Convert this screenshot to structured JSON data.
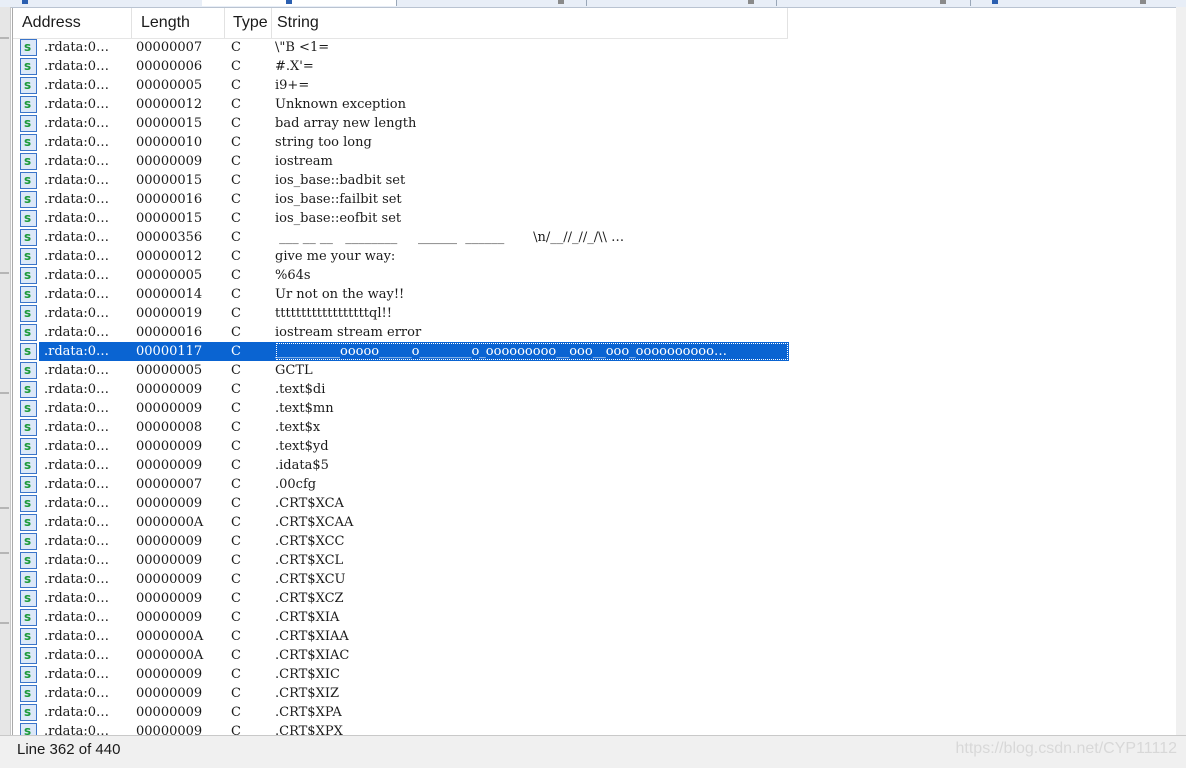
{
  "columns": {
    "address": "Address",
    "length": "Length",
    "type": "Type",
    "string": "String"
  },
  "rows": [
    {
      "address": ".rdata:0…",
      "length": "00000007",
      "type": "C",
      "string": "\\\"B <1="
    },
    {
      "address": ".rdata:0…",
      "length": "00000006",
      "type": "C",
      "string": "#.X'="
    },
    {
      "address": ".rdata:0…",
      "length": "00000005",
      "type": "C",
      "string": "i9+="
    },
    {
      "address": ".rdata:0…",
      "length": "00000012",
      "type": "C",
      "string": "Unknown exception"
    },
    {
      "address": ".rdata:0…",
      "length": "00000015",
      "type": "C",
      "string": "bad array new length"
    },
    {
      "address": ".rdata:0…",
      "length": "00000010",
      "type": "C",
      "string": "string too long"
    },
    {
      "address": ".rdata:0…",
      "length": "00000009",
      "type": "C",
      "string": "iostream"
    },
    {
      "address": ".rdata:0…",
      "length": "00000015",
      "type": "C",
      "string": "ios_base::badbit set"
    },
    {
      "address": ".rdata:0…",
      "length": "00000016",
      "type": "C",
      "string": "ios_base::failbit set"
    },
    {
      "address": ".rdata:0…",
      "length": "00000015",
      "type": "C",
      "string": "ios_base::eofbit set"
    },
    {
      "address": ".rdata:0…",
      "length": "00000356",
      "type": "C",
      "string": " ___ __ __   ________     ______  ______       \\n/__//_//_/\\\\ …"
    },
    {
      "address": ".rdata:0…",
      "length": "00000012",
      "type": "C",
      "string": "give me your way:"
    },
    {
      "address": ".rdata:0…",
      "length": "00000005",
      "type": "C",
      "string": "%64s"
    },
    {
      "address": ".rdata:0…",
      "length": "00000014",
      "type": "C",
      "string": "Ur not on the way!!"
    },
    {
      "address": ".rdata:0…",
      "length": "00000019",
      "type": "C",
      "string": "ttttttttttttttttttql!!"
    },
    {
      "address": ".rdata:0…",
      "length": "00000016",
      "type": "C",
      "string": "iostream stream error"
    },
    {
      "address": ".rdata:0…",
      "length": "00000117",
      "type": "C",
      "string": "__________ooooo_____o________o_ooooooooo__ooo__ooo_oooooooooo…",
      "selected": true
    },
    {
      "address": ".rdata:0…",
      "length": "00000005",
      "type": "C",
      "string": "GCTL"
    },
    {
      "address": ".rdata:0…",
      "length": "00000009",
      "type": "C",
      "string": ".text$di"
    },
    {
      "address": ".rdata:0…",
      "length": "00000009",
      "type": "C",
      "string": ".text$mn"
    },
    {
      "address": ".rdata:0…",
      "length": "00000008",
      "type": "C",
      "string": ".text$x"
    },
    {
      "address": ".rdata:0…",
      "length": "00000009",
      "type": "C",
      "string": ".text$yd"
    },
    {
      "address": ".rdata:0…",
      "length": "00000009",
      "type": "C",
      "string": ".idata$5"
    },
    {
      "address": ".rdata:0…",
      "length": "00000007",
      "type": "C",
      "string": ".00cfg"
    },
    {
      "address": ".rdata:0…",
      "length": "00000009",
      "type": "C",
      "string": ".CRT$XCA"
    },
    {
      "address": ".rdata:0…",
      "length": "0000000A",
      "type": "C",
      "string": ".CRT$XCAA"
    },
    {
      "address": ".rdata:0…",
      "length": "00000009",
      "type": "C",
      "string": ".CRT$XCC"
    },
    {
      "address": ".rdata:0…",
      "length": "00000009",
      "type": "C",
      "string": ".CRT$XCL"
    },
    {
      "address": ".rdata:0…",
      "length": "00000009",
      "type": "C",
      "string": ".CRT$XCU"
    },
    {
      "address": ".rdata:0…",
      "length": "00000009",
      "type": "C",
      "string": ".CRT$XCZ"
    },
    {
      "address": ".rdata:0…",
      "length": "00000009",
      "type": "C",
      "string": ".CRT$XIA"
    },
    {
      "address": ".rdata:0…",
      "length": "0000000A",
      "type": "C",
      "string": ".CRT$XIAA"
    },
    {
      "address": ".rdata:0…",
      "length": "0000000A",
      "type": "C",
      "string": ".CRT$XIAC"
    },
    {
      "address": ".rdata:0…",
      "length": "00000009",
      "type": "C",
      "string": ".CRT$XIC"
    },
    {
      "address": ".rdata:0…",
      "length": "00000009",
      "type": "C",
      "string": ".CRT$XIZ"
    },
    {
      "address": ".rdata:0…",
      "length": "00000009",
      "type": "C",
      "string": ".CRT$XPA"
    },
    {
      "address": ".rdata:0…",
      "length": "00000009",
      "type": "C",
      "string": ".CRT$XPX"
    }
  ],
  "row_icon": "string-item-icon",
  "colors": {
    "selection": "#0a64d2",
    "icon_border": "#3a74c9",
    "icon_glyph": "#1c9a3a"
  },
  "status": {
    "line_info": "Line 362 of 440",
    "watermark": "https://blog.csdn.net/CYP11112"
  }
}
